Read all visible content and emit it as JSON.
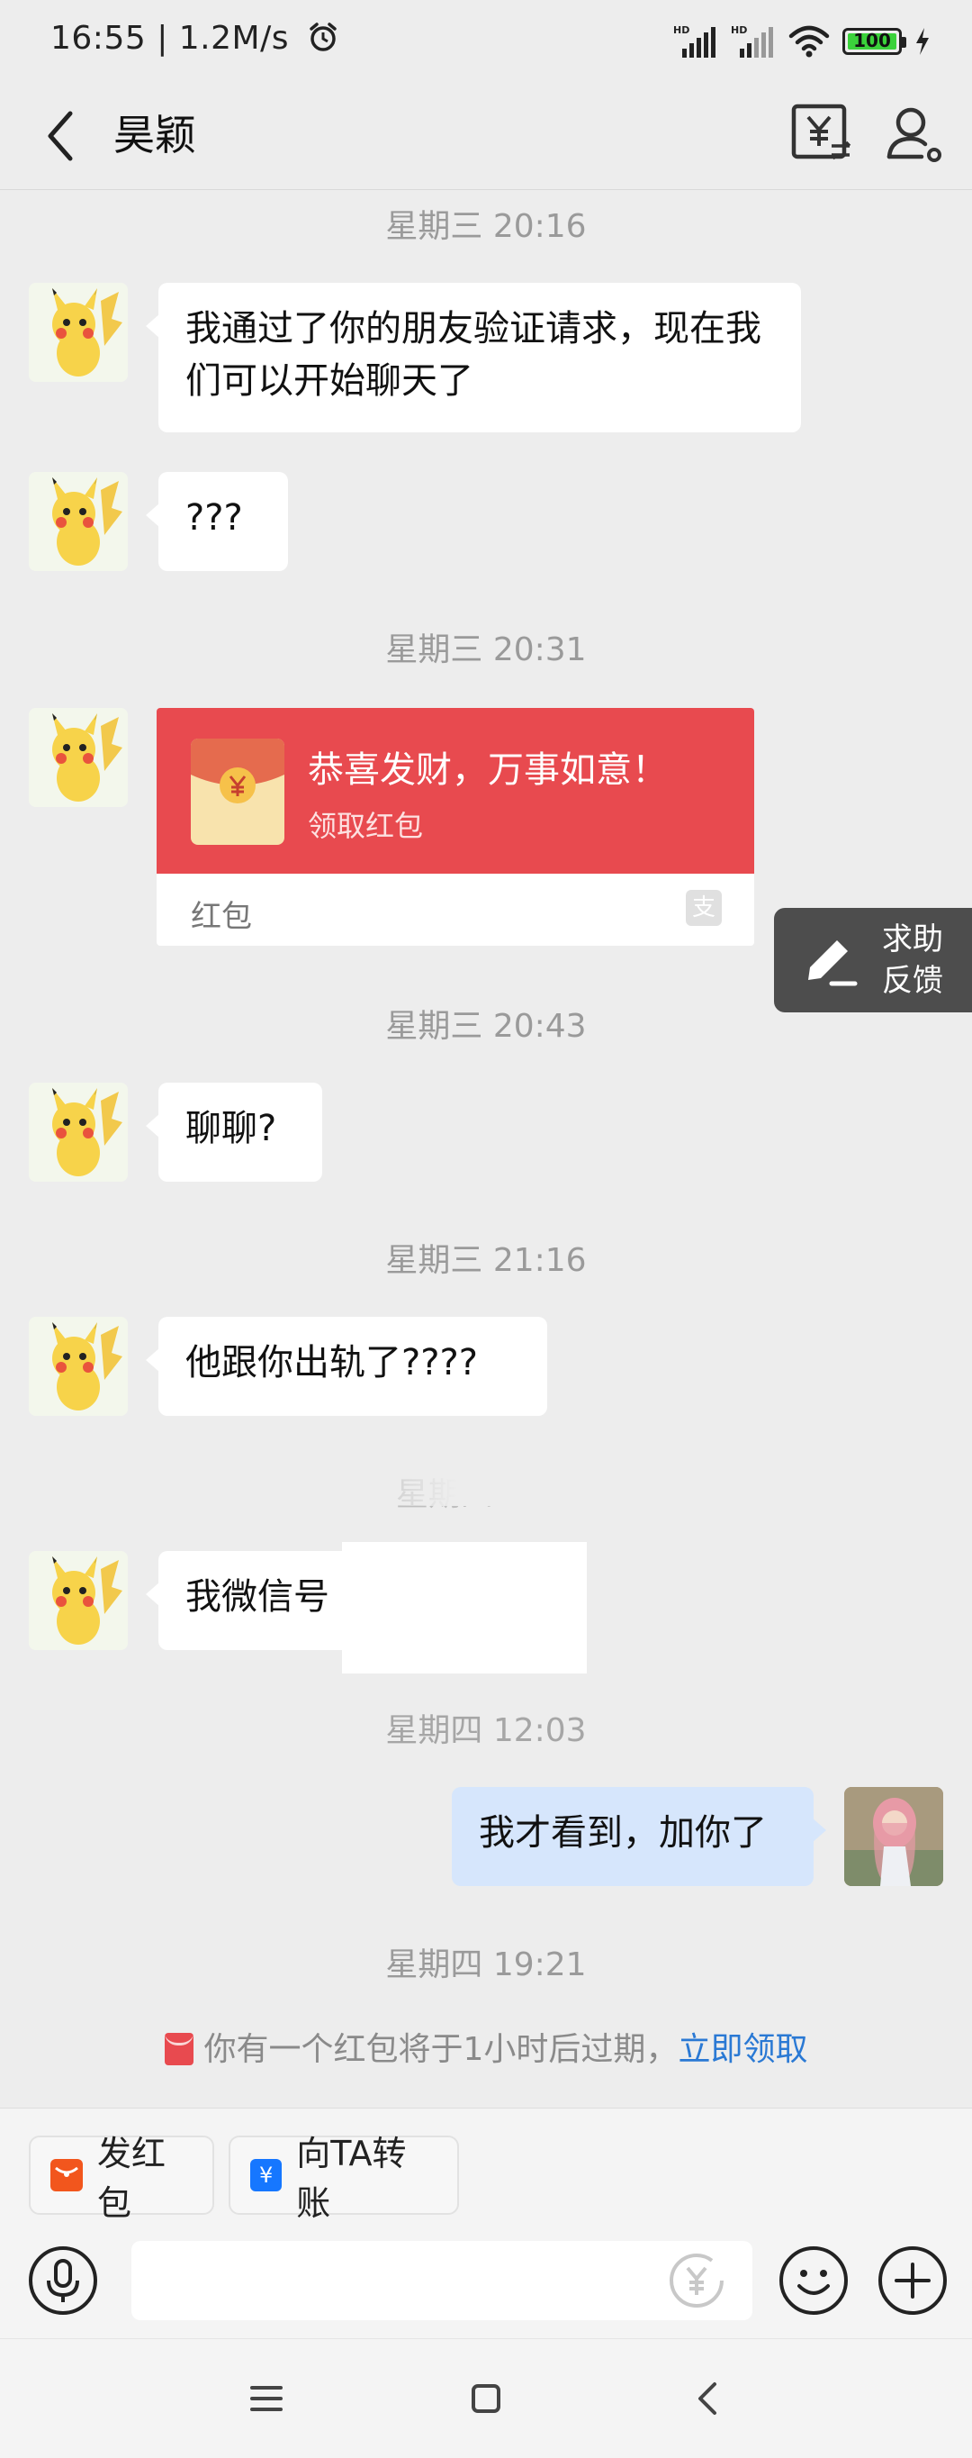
{
  "status_bar": {
    "time_speed": "16:55 | 1.2M/s",
    "hd1": "HD",
    "hd2": "HD",
    "battery": "100"
  },
  "header": {
    "title": "昊颖"
  },
  "messages": [
    {
      "type": "time",
      "text": "星期三 20:16"
    },
    {
      "type": "text",
      "side": "left",
      "text": "我通过了你的朋友验证请求，现在我们可以开始聊天了"
    },
    {
      "type": "text",
      "side": "left",
      "text": "???"
    },
    {
      "type": "time",
      "text": "星期三 20:31"
    },
    {
      "type": "red_packet",
      "side": "left",
      "title": "恭喜发财，万事如意！",
      "subtitle": "领取红包",
      "footer": "红包"
    },
    {
      "type": "time",
      "text": "星期三 20:43"
    },
    {
      "type": "text",
      "side": "left",
      "text": "聊聊?"
    },
    {
      "type": "time",
      "text": "星期三 21:16"
    },
    {
      "type": "text",
      "side": "left",
      "text": "他跟你出轨了????"
    },
    {
      "type": "time",
      "text": "星期四 01:5"
    },
    {
      "type": "text",
      "side": "left",
      "text": "我微信号"
    },
    {
      "type": "time",
      "text": "星期四 12:03"
    },
    {
      "type": "text",
      "side": "right",
      "text": "我才看到，加你了"
    },
    {
      "type": "time",
      "text": "星期四 19:21"
    }
  ],
  "help_button": {
    "line1": "求助",
    "line2": "反馈"
  },
  "notice": {
    "text": "你有一个红包将于1小时后过期，",
    "link": "立即领取"
  },
  "quick_actions": [
    {
      "label": "发红包",
      "icon": "red-packet-icon",
      "color": "#f2561d"
    },
    {
      "label": "向TA转账",
      "icon": "transfer-icon",
      "color": "#1677ff"
    }
  ],
  "colors": {
    "background": "#ededed",
    "red_packet": "#e84a4f",
    "link": "#2a79d4",
    "my_bubble": "#d6e6fc"
  }
}
